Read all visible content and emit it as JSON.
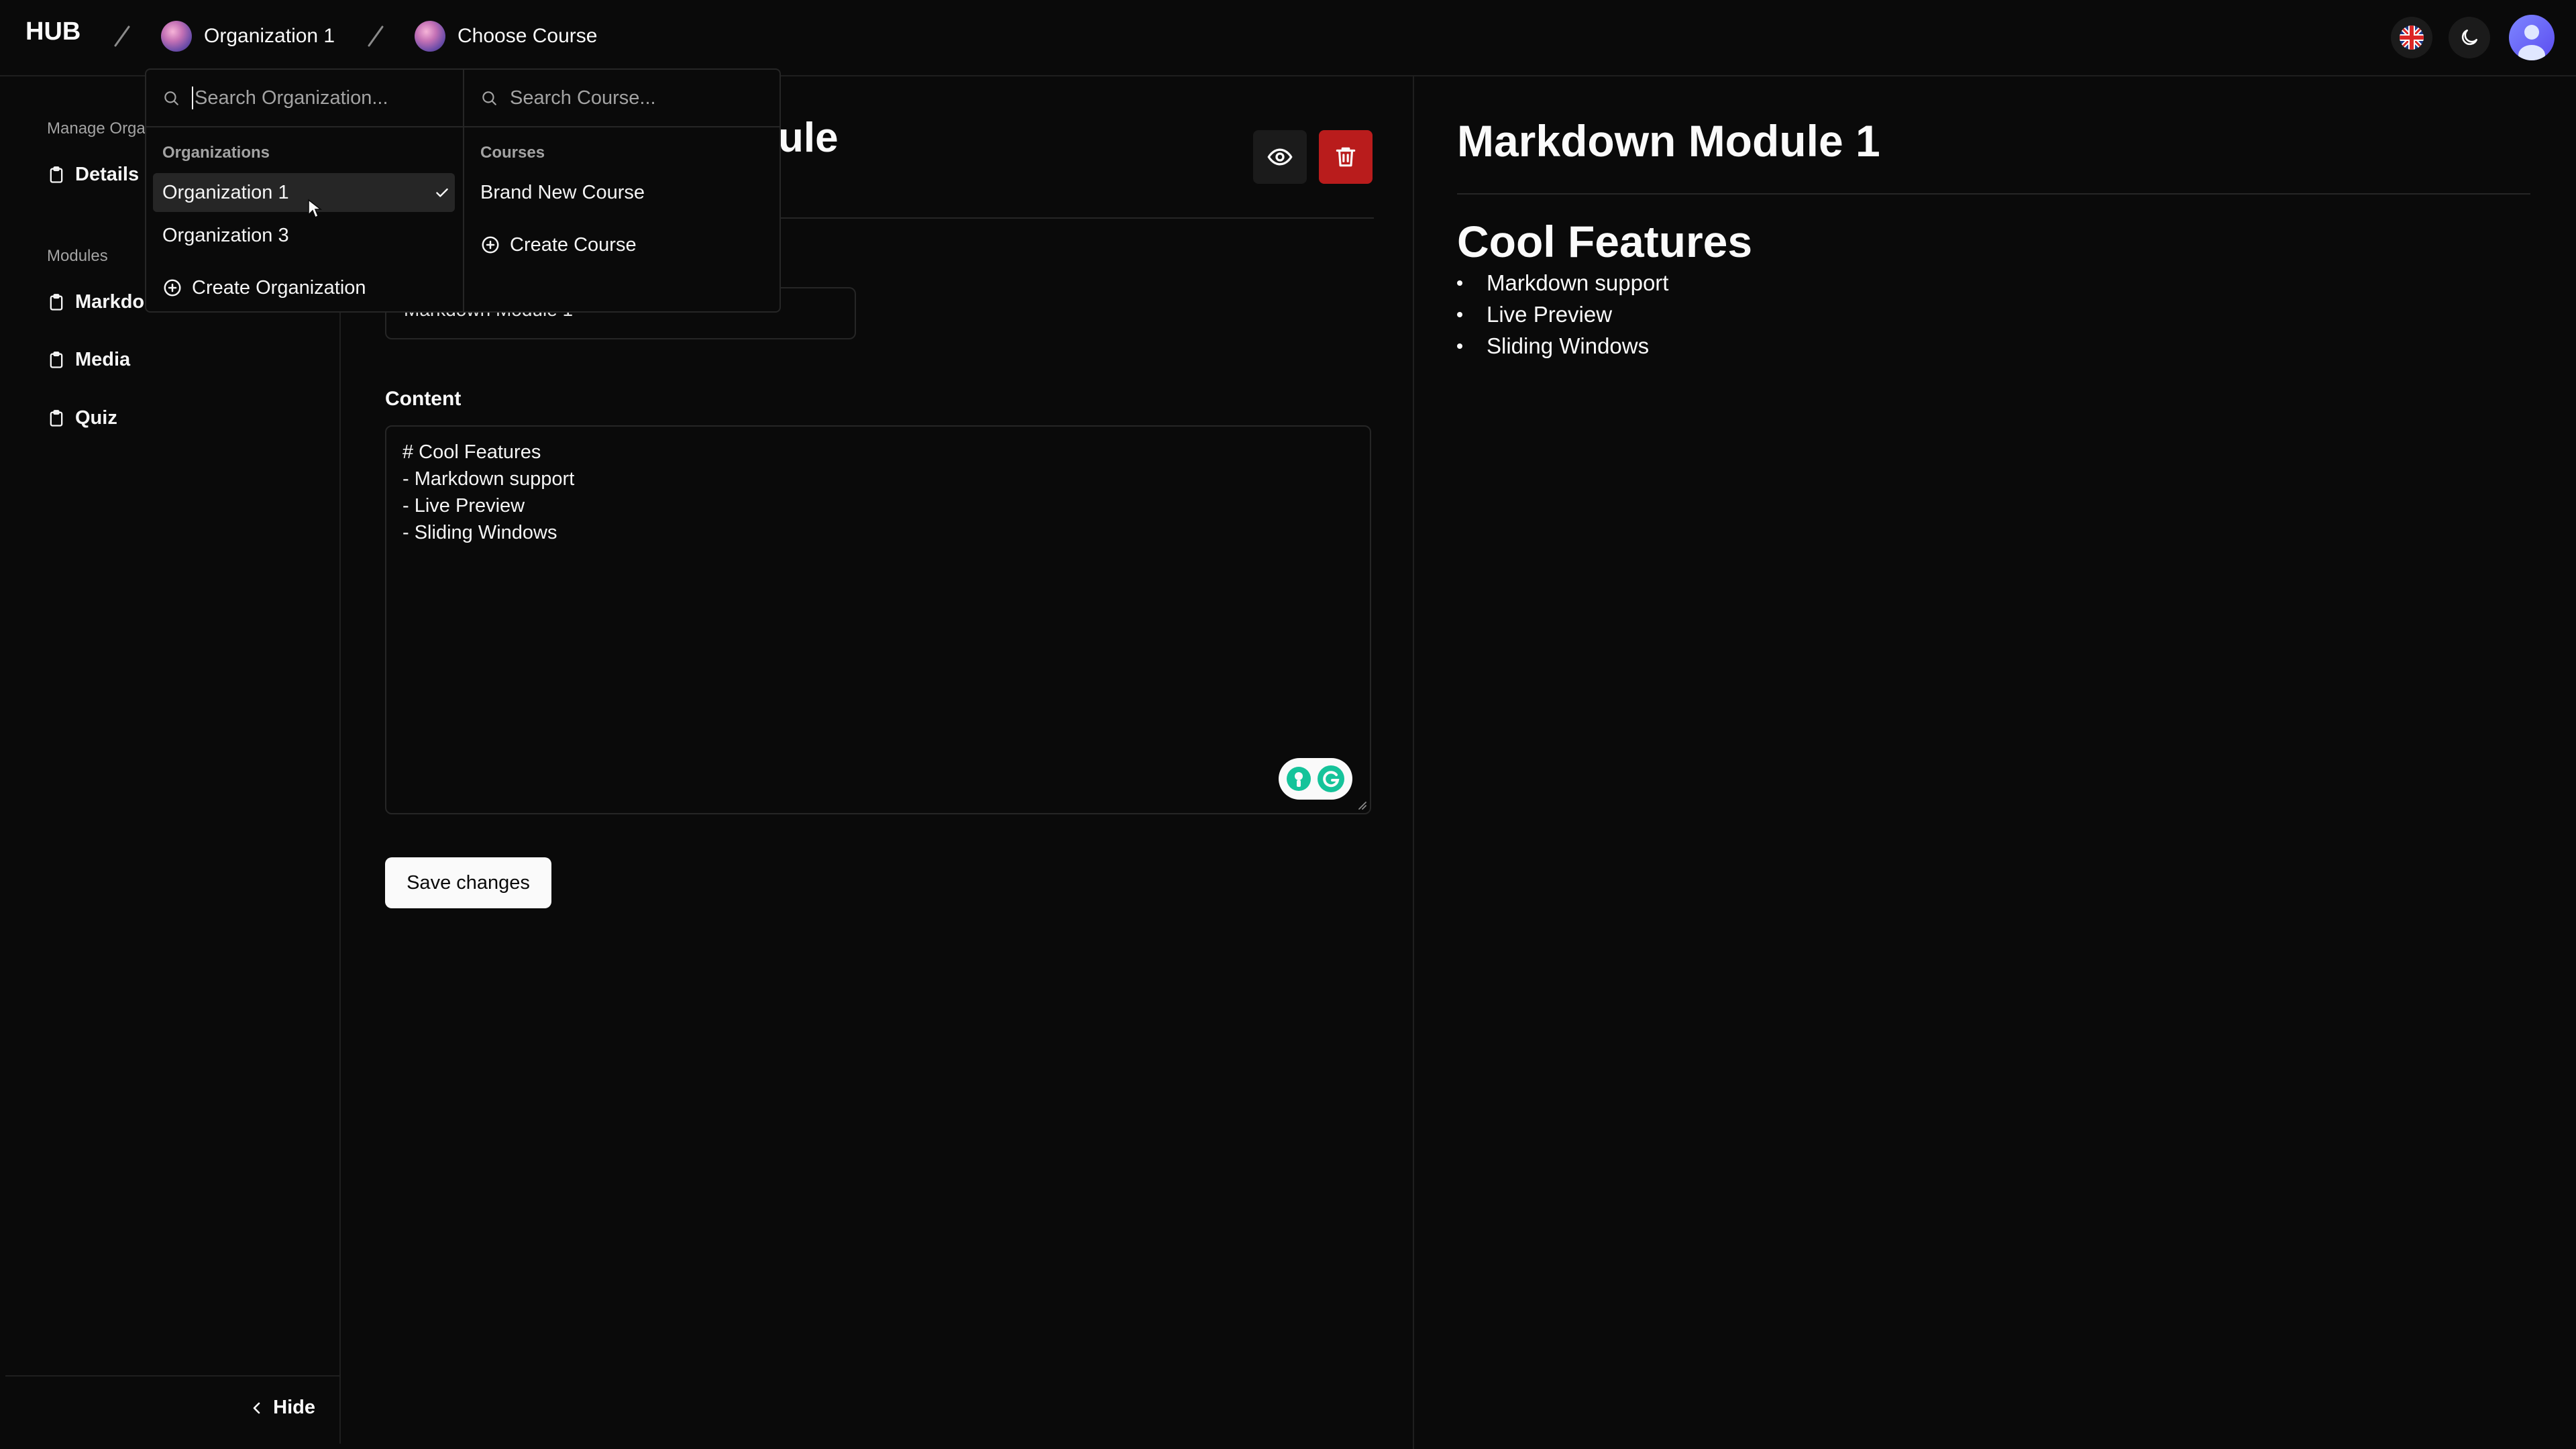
{
  "topbar": {
    "logo": "HUB",
    "org_crumb": "Organization 1",
    "course_crumb": "Choose Course"
  },
  "sidebar": {
    "section_manage": "Manage Orga",
    "details_label": "Details",
    "section_modules": "Modules",
    "modules": [
      {
        "label": "Markdo"
      },
      {
        "label": "Media"
      },
      {
        "label": "Quiz"
      }
    ],
    "hide_label": "Hide"
  },
  "editor": {
    "title_fragment": "ule",
    "name_value": "Markdown Module 1",
    "content_label": "Content",
    "content_lines": [
      "# Cool Features",
      "- Markdown support",
      "- Live Preview",
      "- Sliding Windows"
    ],
    "save_label": "Save changes",
    "delete_color": "#b91c1c"
  },
  "preview": {
    "title": "Markdown Module 1",
    "heading": "Cool Features",
    "bullets": [
      "Markdown support",
      "Live Preview",
      "Sliding Windows"
    ]
  },
  "popover": {
    "org_search_placeholder": "Search Organization...",
    "course_search_placeholder": "Search Course...",
    "org_group_label": "Organizations",
    "organizations": [
      {
        "name": "Organization 1",
        "selected": true
      },
      {
        "name": "Organization 3",
        "selected": false
      }
    ],
    "create_org_label": "Create Organization",
    "course_group_label": "Courses",
    "courses": [
      {
        "name": "Brand New Course"
      }
    ],
    "create_course_label": "Create Course"
  },
  "icons": {
    "language": "uk-flag-icon",
    "theme": "moon-icon",
    "user": "user-avatar",
    "preview": "eye-icon",
    "delete": "trash-icon",
    "grammarly": "grammarly-icon"
  }
}
